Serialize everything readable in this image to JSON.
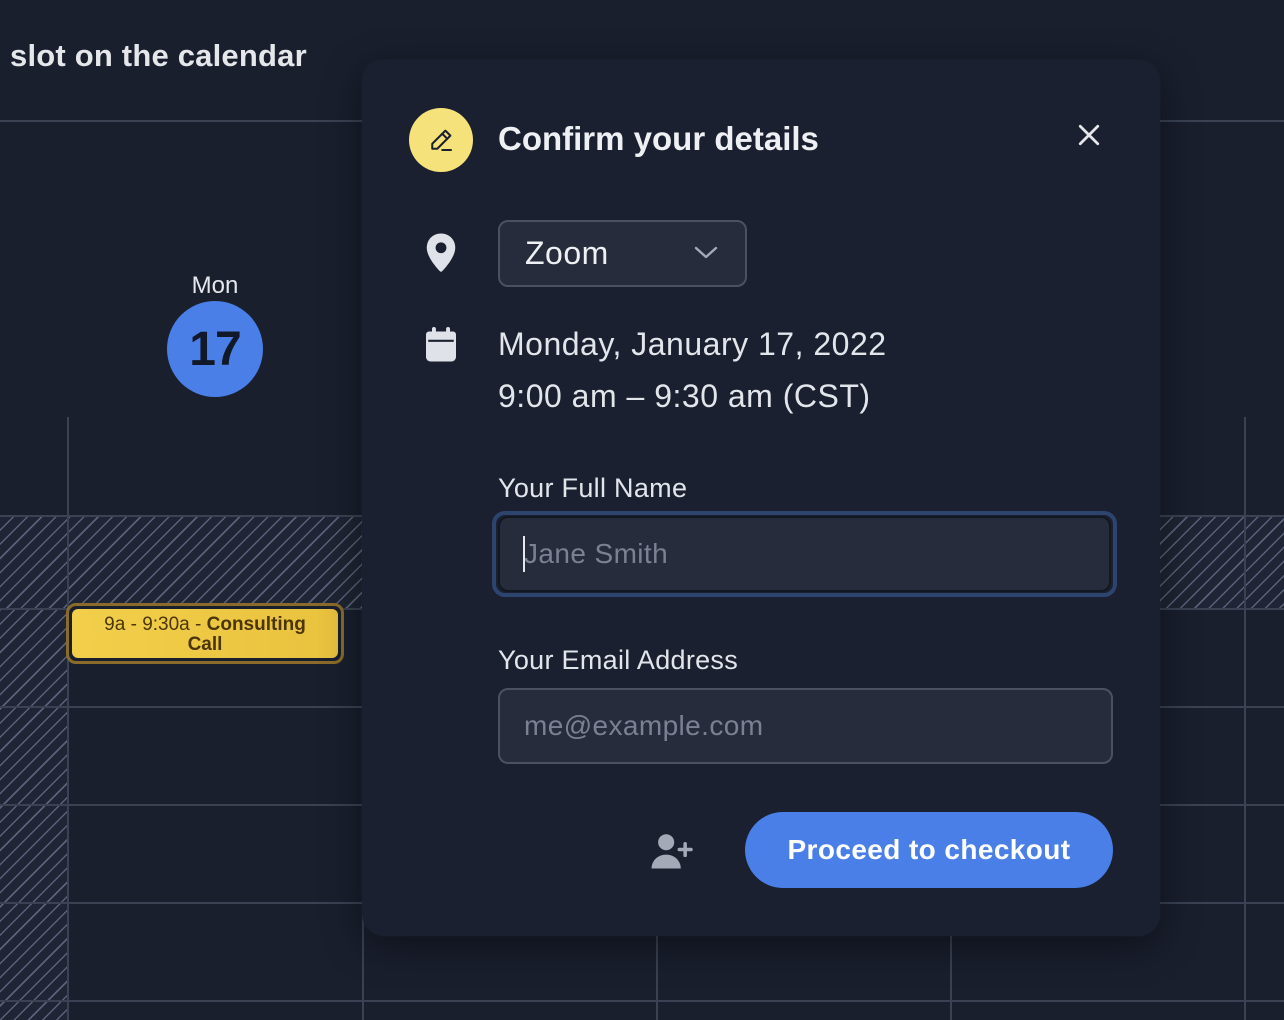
{
  "calendar": {
    "heading": "slot on the calendar",
    "day_label": "Mon",
    "day_number": "17",
    "event": {
      "time": "9a - 9:30a - ",
      "title_part1": "Consulting",
      "title_part2": "Call"
    }
  },
  "modal": {
    "title": "Confirm your details",
    "icons": {
      "header": "pencil-icon",
      "close": "close-icon",
      "location": "map-pin-icon",
      "date": "calendar-icon",
      "chevron": "chevron-down-icon",
      "add_guest": "user-plus-icon"
    },
    "location": {
      "selected": "Zoom"
    },
    "date": {
      "line1": "Monday, January 17, 2022",
      "line2": "9:00 am – 9:30 am (CST)"
    },
    "name_field": {
      "label": "Your Full Name",
      "placeholder": "Jane Smith",
      "value": ""
    },
    "email_field": {
      "label": "Your Email Address",
      "placeholder": "me@example.com",
      "value": ""
    },
    "submit_label": "Proceed to checkout"
  },
  "colors": {
    "background": "#1a1f2e",
    "modal": "#1b2030",
    "accent": "#4a7fe8",
    "event": "#f2cf4a",
    "header_icon_bg": "#f5e27a"
  }
}
